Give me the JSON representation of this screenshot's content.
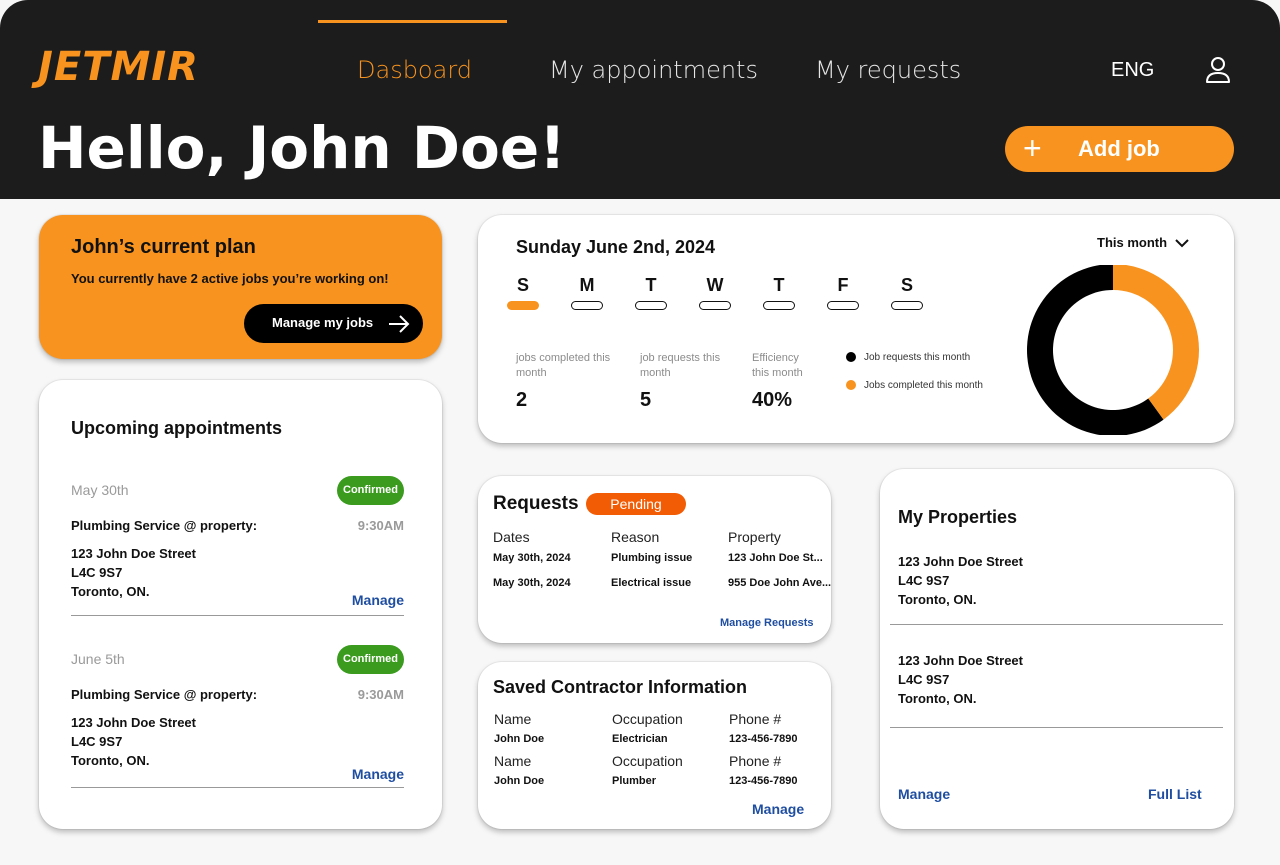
{
  "brand": {
    "logo": "JETMIR",
    "accent": "#f7931e",
    "dark": "#1c1c1c",
    "link": "#1f4ea1",
    "success": "#3a9b1e",
    "pending": "#f25c05"
  },
  "nav": {
    "items": [
      "Dasboard",
      "My appointments",
      "My requests"
    ],
    "active": "Dasboard",
    "lang": "ENG",
    "user_icon": "user-icon"
  },
  "header": {
    "greeting": "Hello, John Doe!",
    "add_job": "Add job"
  },
  "plan": {
    "title": "John’s current plan",
    "subtitle": "You currently have 2 active jobs you’re working on!",
    "button": "Manage my jobs"
  },
  "appointments": {
    "title": "Upcoming appointments",
    "items": [
      {
        "date": "May 30th",
        "status": "Confirmed",
        "service": "Plumbing Service @ property:",
        "time": "9:30AM",
        "addr1": "123 John Doe Street",
        "addr2": "L4C 9S7",
        "addr3": "Toronto, ON.",
        "manage": "Manage"
      },
      {
        "date": "June 5th",
        "status": "Confirmed",
        "service": "Plumbing Service @ property:",
        "time": "9:30AM",
        "addr1": "123 John Doe Street",
        "addr2": "L4C 9S7",
        "addr3": "Toronto, ON.",
        "manage": "Manage"
      }
    ]
  },
  "calendar": {
    "date": "Sunday June 2nd, 2024",
    "days": [
      "S",
      "M",
      "T",
      "W",
      "T",
      "F",
      "S"
    ],
    "active_day": 0,
    "period": "This month",
    "stats": [
      {
        "label": "jobs completed this month",
        "value": "2"
      },
      {
        "label": "job requests this month",
        "value": "5"
      },
      {
        "label": "Efficiency this month",
        "value": "40%"
      }
    ],
    "legend": [
      {
        "label": "Job requests this month",
        "color": "#000000"
      },
      {
        "label": "Jobs completed this month",
        "color": "#f7931e"
      }
    ],
    "donut": {
      "requests": 5,
      "completed": 2
    }
  },
  "requests": {
    "title": "Requests",
    "status": "Pending",
    "headers": [
      "Dates",
      "Reason",
      "Property"
    ],
    "rows": [
      [
        "May 30th, 2024",
        "Plumbing issue",
        "123 John Doe St..."
      ],
      [
        "May 30th, 2024",
        "Electrical issue",
        "955 Doe John Ave..."
      ]
    ],
    "link": "Manage Requests"
  },
  "contractors": {
    "title": "Saved Contractor Information",
    "headers": [
      "Name",
      "Occupation",
      "Phone #"
    ],
    "rows": [
      [
        "John Doe",
        "Electrician",
        "123-456-7890"
      ],
      [
        "John Doe",
        "Plumber",
        "123-456-7890"
      ]
    ],
    "link": "Manage"
  },
  "properties": {
    "title": "My Properties",
    "items": [
      {
        "addr1": "123 John Doe Street",
        "addr2": "L4C 9S7",
        "addr3": "Toronto, ON."
      },
      {
        "addr1": "123 John Doe Street",
        "addr2": "L4C 9S7",
        "addr3": "Toronto, ON."
      }
    ],
    "manage": "Manage",
    "full_list": "Full List"
  }
}
